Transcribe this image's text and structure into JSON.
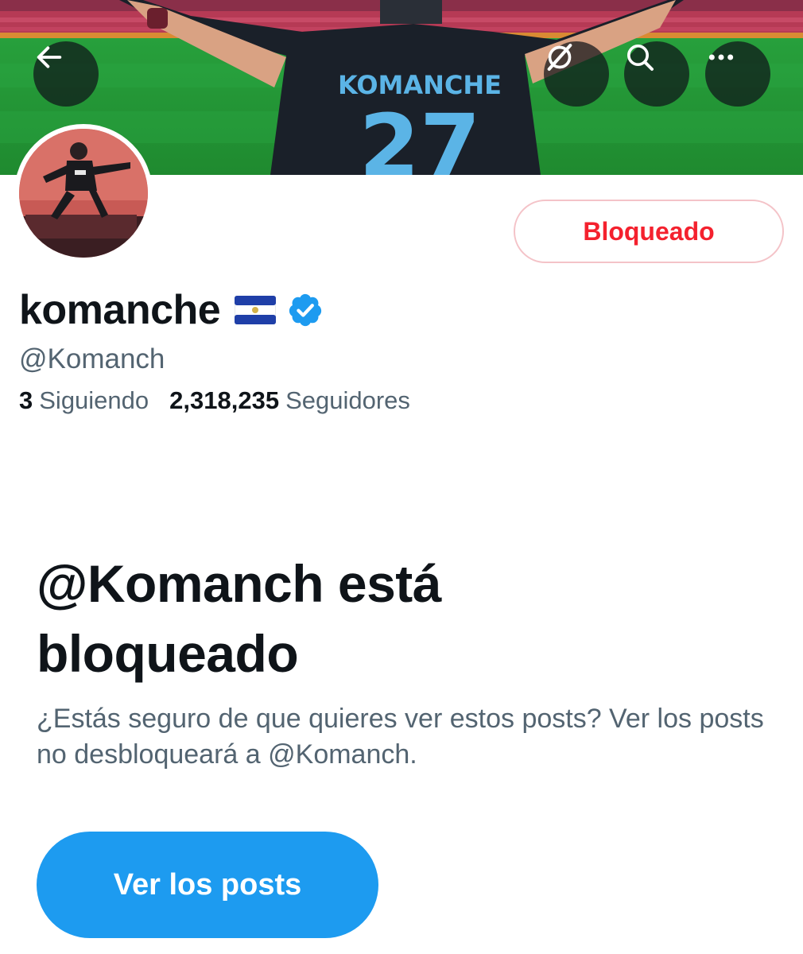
{
  "banner": {
    "jersey_name": "KOMANCHE",
    "jersey_number": "27"
  },
  "icons": {
    "back": "arrow-left-icon",
    "grok": "grok-icon",
    "search": "search-icon",
    "more": "more-horizontal-icon",
    "verified": "verified-badge-icon",
    "flag": "el-salvador-flag-icon"
  },
  "profile": {
    "display_name": "komanche",
    "handle": "@Komanch",
    "following_count": "3",
    "following_label": "Siguiendo",
    "followers_count": "2,318,235",
    "followers_label": "Seguidores"
  },
  "blocked_button_label": "Bloqueado",
  "blocked_notice": {
    "title": "@Komanch está bloqueado",
    "description": "¿Estás seguro de que quieres ver estos posts? Ver los posts no desbloqueará a @Komanch.",
    "button_label": "Ver los posts"
  },
  "colors": {
    "accent_blue": "#1d9bf0",
    "blocked_red": "#f4212e",
    "secondary_text": "#536471",
    "primary_text": "#0f1419"
  }
}
